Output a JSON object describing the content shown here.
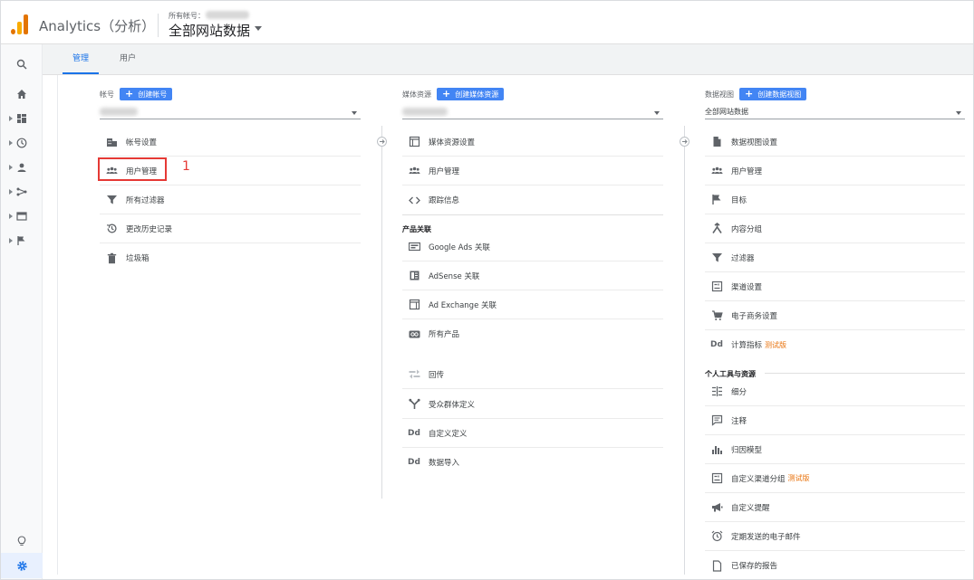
{
  "header": {
    "app_title": "Analytics（分析）",
    "account_label": "所有帐号：",
    "view_title": "全部网站数据"
  },
  "rail": {
    "icons": [
      "search-icon",
      "home-icon",
      "dashboard-icon",
      "clock-icon",
      "person-icon",
      "acquisition-icon",
      "behavior-icon",
      "flag-icon",
      "lightbulb-icon",
      "gear-icon"
    ]
  },
  "tabs": [
    {
      "label": "管理",
      "active": true
    },
    {
      "label": "用户",
      "active": false
    }
  ],
  "account": {
    "label": "帐号",
    "create_button": "创建帐号",
    "items": [
      {
        "icon": "building-icon",
        "label": "帐号设置"
      },
      {
        "icon": "people-icon",
        "label": "用户管理"
      },
      {
        "icon": "filter-icon",
        "label": "所有过滤器"
      },
      {
        "icon": "history-icon",
        "label": "更改历史记录"
      },
      {
        "icon": "trash-icon",
        "label": "垃圾箱"
      }
    ]
  },
  "property": {
    "label": "媒体资源",
    "create_button": "创建媒体资源",
    "items": [
      {
        "icon": "window-icon",
        "label": "媒体资源设置"
      },
      {
        "icon": "people-icon",
        "label": "用户管理"
      },
      {
        "icon": "code-icon",
        "label": "跟踪信息"
      }
    ],
    "section_label": "产品关联",
    "linked_items": [
      {
        "icon": "google-ads-icon",
        "label": "Google Ads 关联"
      },
      {
        "icon": "adsense-icon",
        "label": "AdSense 关联"
      },
      {
        "icon": "ad-exchange-icon",
        "label": "Ad Exchange 关联"
      },
      {
        "icon": "link-icon",
        "label": "所有产品"
      }
    ],
    "more_items": [
      {
        "icon": "postback-icon",
        "label": "回传"
      },
      {
        "icon": "audience-icon",
        "label": "受众群体定义"
      },
      {
        "icon": "dd-icon",
        "label": "自定义定义"
      },
      {
        "icon": "dd-icon",
        "label": "数据导入"
      }
    ]
  },
  "view": {
    "label": "数据视图",
    "create_button": "创建数据视图",
    "selected": "全部网站数据",
    "items": [
      {
        "icon": "document-icon",
        "label": "数据视图设置",
        "beta": ""
      },
      {
        "icon": "people-icon",
        "label": "用户管理",
        "beta": ""
      },
      {
        "icon": "flag-icon",
        "label": "目标",
        "beta": ""
      },
      {
        "icon": "grouping-icon",
        "label": "内容分组",
        "beta": ""
      },
      {
        "icon": "filter-icon",
        "label": "过滤器",
        "beta": ""
      },
      {
        "icon": "channel-icon",
        "label": "渠道设置",
        "beta": ""
      },
      {
        "icon": "cart-icon",
        "label": "电子商务设置",
        "beta": ""
      },
      {
        "icon": "dd-icon",
        "label": "计算指标",
        "beta": "测试版"
      }
    ],
    "section_label": "个人工具与资源",
    "personal_items": [
      {
        "icon": "segment-icon",
        "label": "细分",
        "beta": ""
      },
      {
        "icon": "comment-icon",
        "label": "注释",
        "beta": ""
      },
      {
        "icon": "attribution-icon",
        "label": "归因模型",
        "beta": ""
      },
      {
        "icon": "channel-icon",
        "label": "自定义渠道分组",
        "beta": "测试版"
      },
      {
        "icon": "megaphone-icon",
        "label": "自定义提醒",
        "beta": ""
      },
      {
        "icon": "alarm-icon",
        "label": "定期发送的电子邮件",
        "beta": ""
      },
      {
        "icon": "saved-report-icon",
        "label": "已保存的报告",
        "beta": ""
      }
    ]
  },
  "annotation": {
    "number": "1",
    "color": "#e53935"
  },
  "colors": {
    "accent": "#1a73e8",
    "button": "#4285f4",
    "beta": "#e8710a"
  }
}
